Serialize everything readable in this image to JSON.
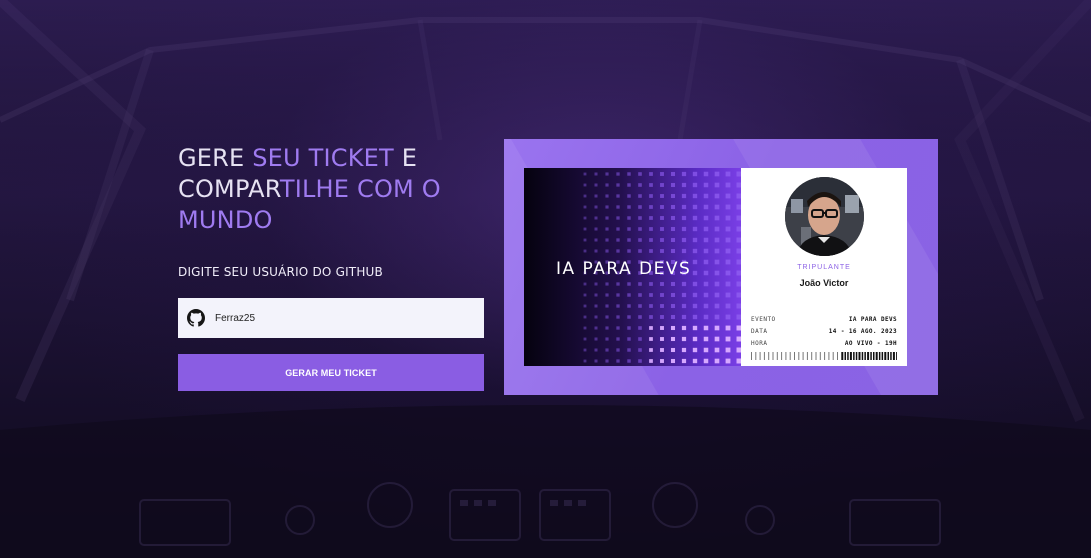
{
  "headline": {
    "part1": "GERE ",
    "accent1": "SEU TICKET",
    "part2": " E",
    "part3": "COMPAR",
    "accent2": "TILHE COM O",
    "part4": "MUNDO"
  },
  "form": {
    "github_label": "DIGITE SEU USUÁRIO DO GITHUB",
    "username_value": "Ferraz25",
    "submit_label": "GERAR MEU TICKET"
  },
  "ticket": {
    "brand": "IA PARA DEVS",
    "role_label": "TRIPULANTE",
    "name": "João Victor",
    "details": [
      {
        "key": "EVENTO",
        "value": "IA PARA DEVS"
      },
      {
        "key": "DATA",
        "value": "14 - 16 AGO. 2023"
      },
      {
        "key": "HORA",
        "value": "AO VIVO - 19H"
      }
    ]
  },
  "colors": {
    "accent": "#9f7bf0",
    "button": "#8a5de3",
    "ticket_frame": "#8b62e6"
  }
}
